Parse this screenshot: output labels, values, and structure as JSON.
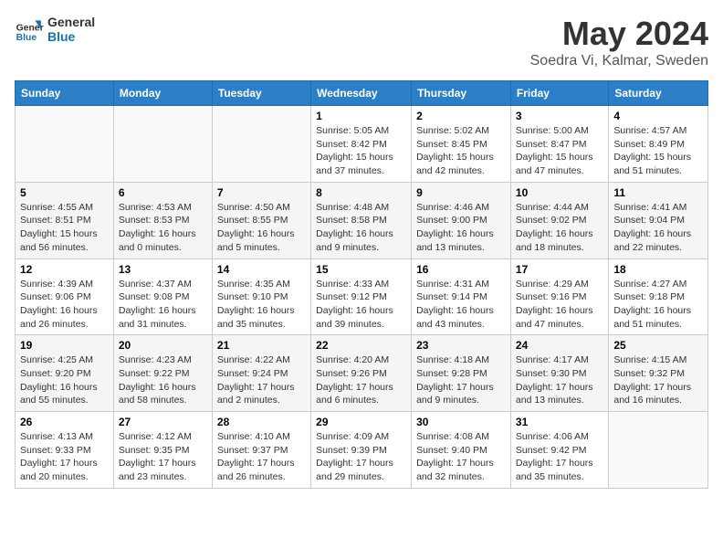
{
  "logo": {
    "line1": "General",
    "line2": "Blue"
  },
  "title": "May 2024",
  "subtitle": "Soedra Vi, Kalmar, Sweden",
  "columns": [
    "Sunday",
    "Monday",
    "Tuesday",
    "Wednesday",
    "Thursday",
    "Friday",
    "Saturday"
  ],
  "weeks": [
    [
      {
        "day": "",
        "info": ""
      },
      {
        "day": "",
        "info": ""
      },
      {
        "day": "",
        "info": ""
      },
      {
        "day": "1",
        "info": "Sunrise: 5:05 AM\nSunset: 8:42 PM\nDaylight: 15 hours\nand 37 minutes."
      },
      {
        "day": "2",
        "info": "Sunrise: 5:02 AM\nSunset: 8:45 PM\nDaylight: 15 hours\nand 42 minutes."
      },
      {
        "day": "3",
        "info": "Sunrise: 5:00 AM\nSunset: 8:47 PM\nDaylight: 15 hours\nand 47 minutes."
      },
      {
        "day": "4",
        "info": "Sunrise: 4:57 AM\nSunset: 8:49 PM\nDaylight: 15 hours\nand 51 minutes."
      }
    ],
    [
      {
        "day": "5",
        "info": "Sunrise: 4:55 AM\nSunset: 8:51 PM\nDaylight: 15 hours\nand 56 minutes."
      },
      {
        "day": "6",
        "info": "Sunrise: 4:53 AM\nSunset: 8:53 PM\nDaylight: 16 hours\nand 0 minutes."
      },
      {
        "day": "7",
        "info": "Sunrise: 4:50 AM\nSunset: 8:55 PM\nDaylight: 16 hours\nand 5 minutes."
      },
      {
        "day": "8",
        "info": "Sunrise: 4:48 AM\nSunset: 8:58 PM\nDaylight: 16 hours\nand 9 minutes."
      },
      {
        "day": "9",
        "info": "Sunrise: 4:46 AM\nSunset: 9:00 PM\nDaylight: 16 hours\nand 13 minutes."
      },
      {
        "day": "10",
        "info": "Sunrise: 4:44 AM\nSunset: 9:02 PM\nDaylight: 16 hours\nand 18 minutes."
      },
      {
        "day": "11",
        "info": "Sunrise: 4:41 AM\nSunset: 9:04 PM\nDaylight: 16 hours\nand 22 minutes."
      }
    ],
    [
      {
        "day": "12",
        "info": "Sunrise: 4:39 AM\nSunset: 9:06 PM\nDaylight: 16 hours\nand 26 minutes."
      },
      {
        "day": "13",
        "info": "Sunrise: 4:37 AM\nSunset: 9:08 PM\nDaylight: 16 hours\nand 31 minutes."
      },
      {
        "day": "14",
        "info": "Sunrise: 4:35 AM\nSunset: 9:10 PM\nDaylight: 16 hours\nand 35 minutes."
      },
      {
        "day": "15",
        "info": "Sunrise: 4:33 AM\nSunset: 9:12 PM\nDaylight: 16 hours\nand 39 minutes."
      },
      {
        "day": "16",
        "info": "Sunrise: 4:31 AM\nSunset: 9:14 PM\nDaylight: 16 hours\nand 43 minutes."
      },
      {
        "day": "17",
        "info": "Sunrise: 4:29 AM\nSunset: 9:16 PM\nDaylight: 16 hours\nand 47 minutes."
      },
      {
        "day": "18",
        "info": "Sunrise: 4:27 AM\nSunset: 9:18 PM\nDaylight: 16 hours\nand 51 minutes."
      }
    ],
    [
      {
        "day": "19",
        "info": "Sunrise: 4:25 AM\nSunset: 9:20 PM\nDaylight: 16 hours\nand 55 minutes."
      },
      {
        "day": "20",
        "info": "Sunrise: 4:23 AM\nSunset: 9:22 PM\nDaylight: 16 hours\nand 58 minutes."
      },
      {
        "day": "21",
        "info": "Sunrise: 4:22 AM\nSunset: 9:24 PM\nDaylight: 17 hours\nand 2 minutes."
      },
      {
        "day": "22",
        "info": "Sunrise: 4:20 AM\nSunset: 9:26 PM\nDaylight: 17 hours\nand 6 minutes."
      },
      {
        "day": "23",
        "info": "Sunrise: 4:18 AM\nSunset: 9:28 PM\nDaylight: 17 hours\nand 9 minutes."
      },
      {
        "day": "24",
        "info": "Sunrise: 4:17 AM\nSunset: 9:30 PM\nDaylight: 17 hours\nand 13 minutes."
      },
      {
        "day": "25",
        "info": "Sunrise: 4:15 AM\nSunset: 9:32 PM\nDaylight: 17 hours\nand 16 minutes."
      }
    ],
    [
      {
        "day": "26",
        "info": "Sunrise: 4:13 AM\nSunset: 9:33 PM\nDaylight: 17 hours\nand 20 minutes."
      },
      {
        "day": "27",
        "info": "Sunrise: 4:12 AM\nSunset: 9:35 PM\nDaylight: 17 hours\nand 23 minutes."
      },
      {
        "day": "28",
        "info": "Sunrise: 4:10 AM\nSunset: 9:37 PM\nDaylight: 17 hours\nand 26 minutes."
      },
      {
        "day": "29",
        "info": "Sunrise: 4:09 AM\nSunset: 9:39 PM\nDaylight: 17 hours\nand 29 minutes."
      },
      {
        "day": "30",
        "info": "Sunrise: 4:08 AM\nSunset: 9:40 PM\nDaylight: 17 hours\nand 32 minutes."
      },
      {
        "day": "31",
        "info": "Sunrise: 4:06 AM\nSunset: 9:42 PM\nDaylight: 17 hours\nand 35 minutes."
      },
      {
        "day": "",
        "info": ""
      }
    ]
  ]
}
